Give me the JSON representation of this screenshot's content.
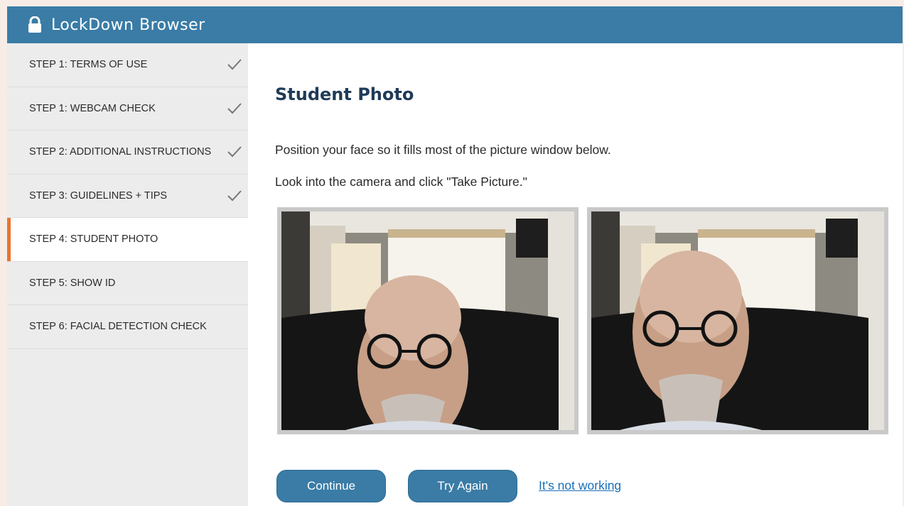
{
  "app": {
    "title": "LockDown Browser"
  },
  "sidebar": {
    "steps": [
      {
        "label": "STEP 1: TERMS OF USE",
        "completed": true
      },
      {
        "label": "STEP 1: WEBCAM CHECK",
        "completed": true
      },
      {
        "label": "STEP 2: ADDITIONAL INSTRUCTIONS",
        "completed": true
      },
      {
        "label": "STEP 3: GUIDELINES + TIPS",
        "completed": true
      },
      {
        "label": "STEP 4: STUDENT PHOTO",
        "active": true
      },
      {
        "label": "STEP 5: SHOW ID"
      },
      {
        "label": "STEP 6: FACIAL DETECTION CHECK"
      }
    ]
  },
  "main": {
    "title": "Student Photo",
    "instruction_1": "Position your face so it fills most of the picture window below.",
    "instruction_2": "Look into the camera and click \"Take Picture.\"",
    "photos": [
      "webcam-live-preview",
      "captured-student-photo"
    ]
  },
  "actions": {
    "continue_label": "Continue",
    "try_again_label": "Try Again",
    "not_working_label": "It's not working"
  },
  "colors": {
    "titlebar": "#3a7ca6",
    "active_indicator": "#e8762d",
    "heading": "#1f3b57",
    "link": "#1a6fb7"
  }
}
